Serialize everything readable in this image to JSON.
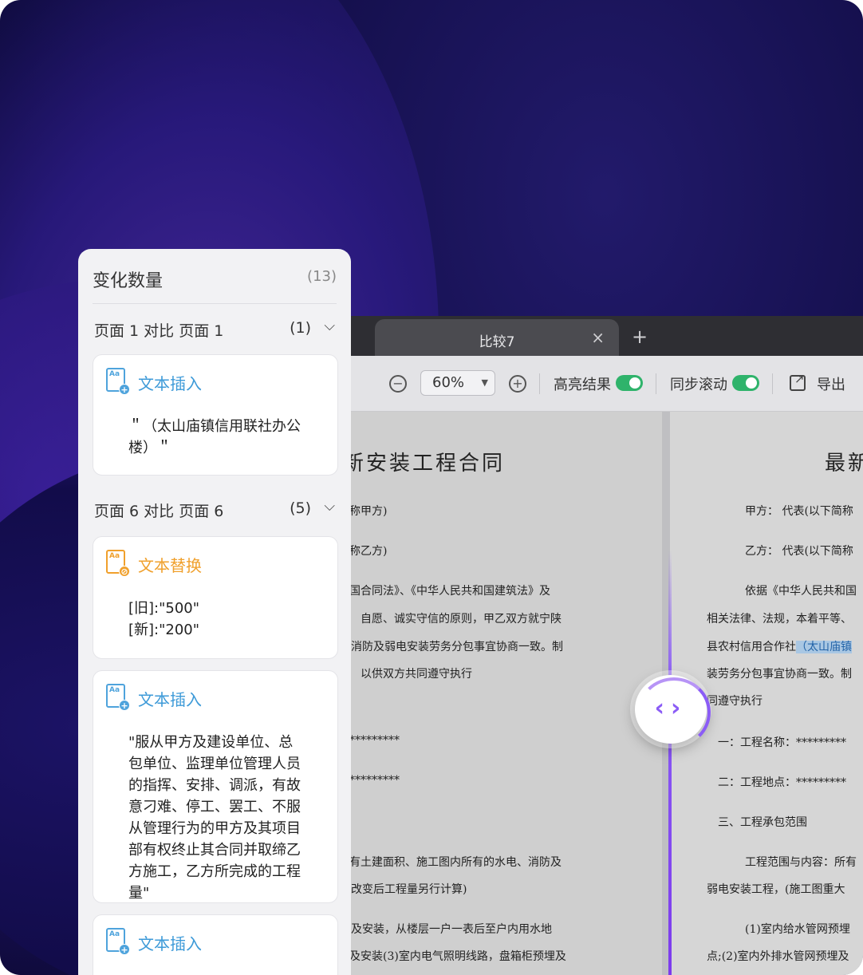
{
  "tab": {
    "title": "比较7",
    "close": "×",
    "add": "+"
  },
  "toolbar": {
    "zoom_out": "−",
    "zoom_value": "60%",
    "zoom_caret": "▼",
    "zoom_in": "+",
    "highlight_label": "高亮结果",
    "sync_scroll_label": "同步滚动",
    "export_label": "导出"
  },
  "doc_left": {
    "title": "新安装工程合同",
    "lines": [
      "称甲方)",
      "称乙方)",
      "国合同法》、《中华人民共和国建筑法》及",
      "自愿、诚实守信的原则，甲乙双方就宁陕",
      "消防及弱电安装劳务分包事宜协商一致。制",
      "以供双方共同遵守执行",
      "*********",
      "*********",
      "有土建面积、施工图内所有的水电、消防及",
      "改变后工程量另行计算)",
      "及安装，从楼层一户一表后至户内用水地",
      "及安装(3)室内电气照明线路，盘箱柜预埋及"
    ]
  },
  "doc_right": {
    "title": "最新",
    "lines": [
      "甲方：  代表(以下简称",
      "乙方：  代表(以下简称",
      "依据《中华人民共和国",
      "相关法律、法规，本着平等、",
      "县农村信用合作社",
      "（太山庙镇",
      "装劳务分包事宜协商一致。制",
      "同遵守执行",
      "一：工程名称：*********",
      "二：工程地点：*********",
      "三、工程承包范围",
      "工程范围与内容：所有",
      "弱电安装工程，(施工图重大",
      "(1)室内给水管网预埋",
      "点;(2)室内外排水管网预埋及"
    ]
  },
  "compare_knob": {
    "arrows": "‹›"
  },
  "panel": {
    "title": "变化数量",
    "count": "(13)",
    "groups": [
      {
        "label": "页面 1 对比 页面 1",
        "count": "(1)",
        "chevron": "⌵"
      },
      {
        "label": "页面 6 对比 页面 6",
        "count": "(5)",
        "chevron": "⌵"
      }
    ],
    "cards": [
      {
        "type": "文本插入",
        "icon": "Aa",
        "badge": "+",
        "body": "＂（太山庙镇信用联社办公楼）＂"
      },
      {
        "type": "文本替换",
        "icon": "Aa",
        "badge": "⊘",
        "body_old": "[旧]:\"500\"",
        "body_new": "[新]:\"200\""
      },
      {
        "type": "文本插入",
        "icon": "Aa",
        "badge": "+",
        "body": "\"服从甲方及建设单位、总包单位、监理单位管理人员的指挥、安排、调派，有故意刁难、停工、罢工、不服从管理行为的甲方及其项目部有权终止其合同并取缔乙方施工，乙方所完成的工程量\""
      },
      {
        "type": "文本插入",
        "icon": "Aa",
        "badge": "+"
      }
    ]
  },
  "colors": {
    "insert_blue": "#3d9ad8",
    "replace_orange": "#f0a02c",
    "toggle_green": "#2fb36b",
    "accent_purple": "#8b5cf6"
  }
}
